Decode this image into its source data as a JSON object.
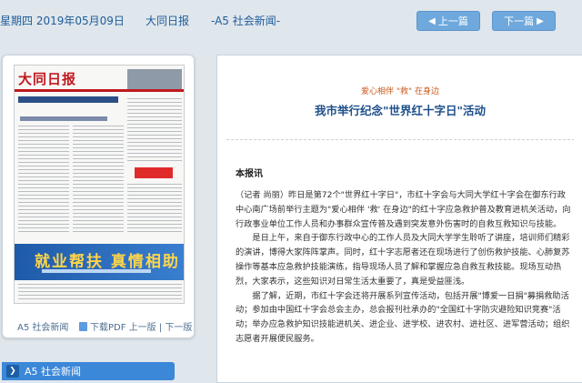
{
  "header": {
    "date": "星期四 2019年05月09日",
    "paper_name": "大同日报",
    "section": "-A5 社会新闻-",
    "prev_label": "上一篇",
    "next_label": "下一篇"
  },
  "thumbnail": {
    "masthead": "大同日报",
    "banner_text": "就业帮扶 真情相助",
    "footer_section": "A5 社会新闻",
    "footer_pdf": "下载PDF",
    "footer_prev": "上一版",
    "footer_sep": "|",
    "footer_next": "下一版"
  },
  "sidebar": {
    "active_section": "A5  社会新闻"
  },
  "article": {
    "kicker": "爱心相伴 \"救\" 在身边",
    "title": "我市举行纪念\"世界红十字日\"活动",
    "byline": "本报讯",
    "paragraphs": [
      "（记者 尚丽）昨日是第72个\"世界红十字日\"，市红十字会与大同大学红十字会在御东行政中心南广场前举行主题为\"爱心相伴 '救' 在身边\"的红十字应急救护普及教育进机关活动，向行政事业单位工作人员和办事群众宣传普及遇到突发意外伤害时的自救互救知识与技能。",
      "是日上午，来自于御东行政中心的工作人员及大同大学学生聆听了讲座，培训师们精彩的演讲，博得大家阵阵掌声。同时，红十字志愿者还在现场进行了创伤救护技能、心肺复苏操作等基本应急救护技能演练，指导现场人员了解和掌握应急自救互救技能。现场互动热烈，大家表示，这些知识对日常生活太重要了，真是受益匪浅。",
      "据了解，近期，市红十字会还将开展系列宣传活动，包括开展\"博爱一日捐\"募捐救助活动；参加由中国红十字会总会主办，总会报刊社承办的\"全国红十字防灾避险知识竞赛\"活动；举办应急救护知识技能进机关、进企业、进学校、进农村、进社区、进军营活动；组织志愿者开展便民服务。"
    ]
  }
}
